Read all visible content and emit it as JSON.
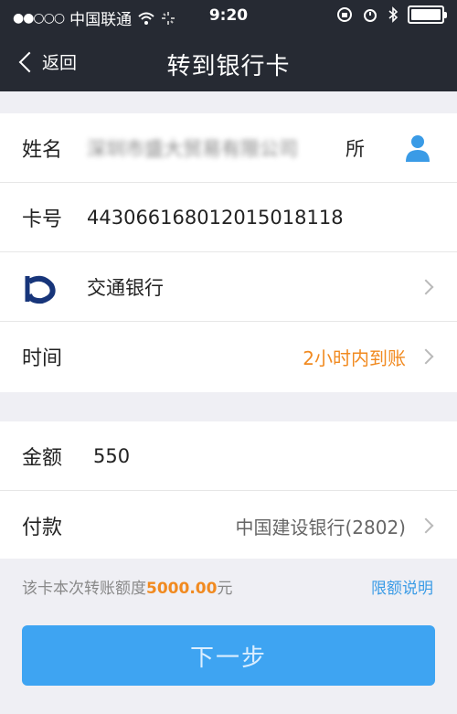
{
  "status_bar": {
    "signal": "●●○○○",
    "carrier": "中国联通",
    "time": "9:20",
    "icons": [
      "wifi-icon",
      "activity-icon",
      "orientation-lock-icon",
      "alarm-icon",
      "bluetooth-icon",
      "battery-icon"
    ]
  },
  "nav": {
    "back_label": "返回",
    "title": "转到银行卡"
  },
  "form": {
    "name_label": "姓名",
    "name_value": "深圳市盛大贸易有限公司",
    "name_value_visible_suffix": "所",
    "card_label": "卡号",
    "card_value": "4430661680120150181​18",
    "bank_name": "交通银行",
    "time_label": "时间",
    "time_value": "2小时内到账",
    "amount_label": "金额",
    "amount_value": "550",
    "pay_label": "付款",
    "pay_value": "中国建设银行(2802)"
  },
  "note": {
    "prefix": "该卡本次转账额度",
    "limit": "5000.00",
    "suffix": "元",
    "link": "限额说明"
  },
  "button": {
    "next_label": "下一步"
  },
  "colors": {
    "header_bg": "#262a33",
    "accent_orange": "#f18a20",
    "link_blue": "#3a9be6",
    "button_blue": "#3ea4f2"
  }
}
